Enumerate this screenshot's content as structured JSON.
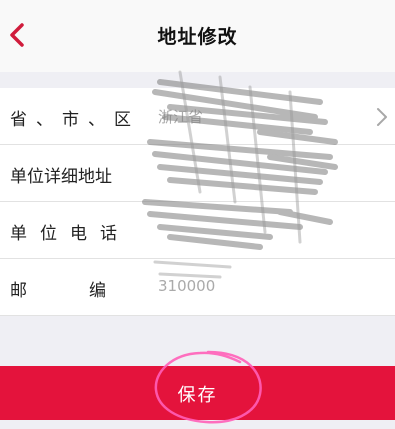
{
  "header": {
    "title": "地址修改",
    "back_icon": "chevron-left-icon",
    "accent_color": "#e4133c"
  },
  "form": {
    "rows": [
      {
        "label": "省、市、区",
        "value": "浙江省",
        "has_chevron": true
      },
      {
        "label": "单位详细地址",
        "value": "",
        "has_chevron": false
      },
      {
        "label": "单位电话",
        "value": "",
        "has_chevron": false
      },
      {
        "label": "邮编",
        "value": "310000",
        "has_chevron": false
      }
    ]
  },
  "footer": {
    "save_label": "保存",
    "save_color": "#e4133c"
  }
}
